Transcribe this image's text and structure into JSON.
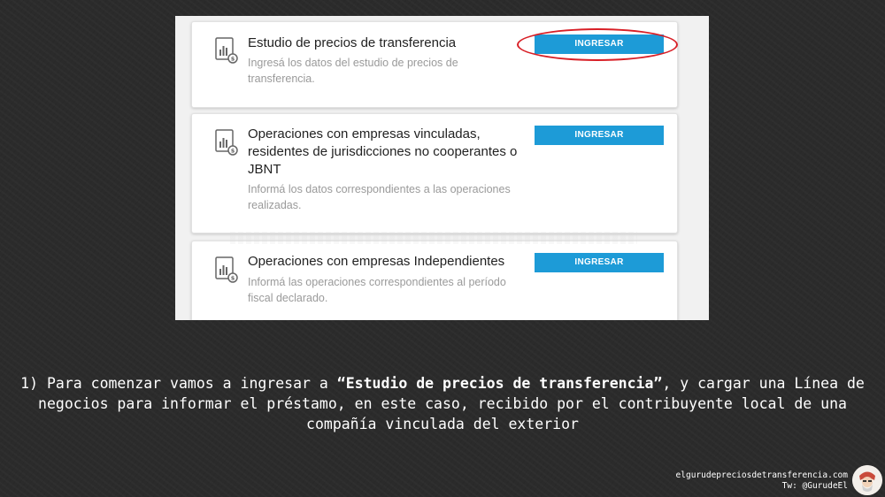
{
  "cards": [
    {
      "icon": "chart-document-icon",
      "title": "Estudio de precios de transferencia",
      "description": "Ingresá los datos del estudio de precios de transferencia.",
      "button_label": "INGRESAR"
    },
    {
      "icon": "chart-document-icon",
      "title": "Operaciones con empresas vinculadas, residentes de jurisdicciones no cooperantes o JBNT",
      "description": "Informá los datos correspondientes a las operaciones realizadas.",
      "button_label": "INGRESAR"
    },
    {
      "icon": "chart-document-icon",
      "title": "Operaciones con empresas Independientes",
      "description": "Informá las operaciones correspondientes al período fiscal declarado.",
      "button_label": "INGRESAR"
    }
  ],
  "caption": {
    "number": "1)",
    "text_before": " Para comenzar vamos a ingresar a ",
    "highlight": "“Estudio de precios de transferencia”",
    "text_after_line1": ", y cargar una Línea de",
    "line2": "negocios para informar el préstamo, en este caso, recibido por el contribuyente local de una",
    "line3": "compañía vinculada del exterior"
  },
  "footer": {
    "website": "elgurudepreciosdetransferencia.com",
    "twitter": "Tw: @GurudeEl"
  },
  "colors": {
    "button": "#1d9bd7",
    "highlight_ring": "#d81f26"
  }
}
